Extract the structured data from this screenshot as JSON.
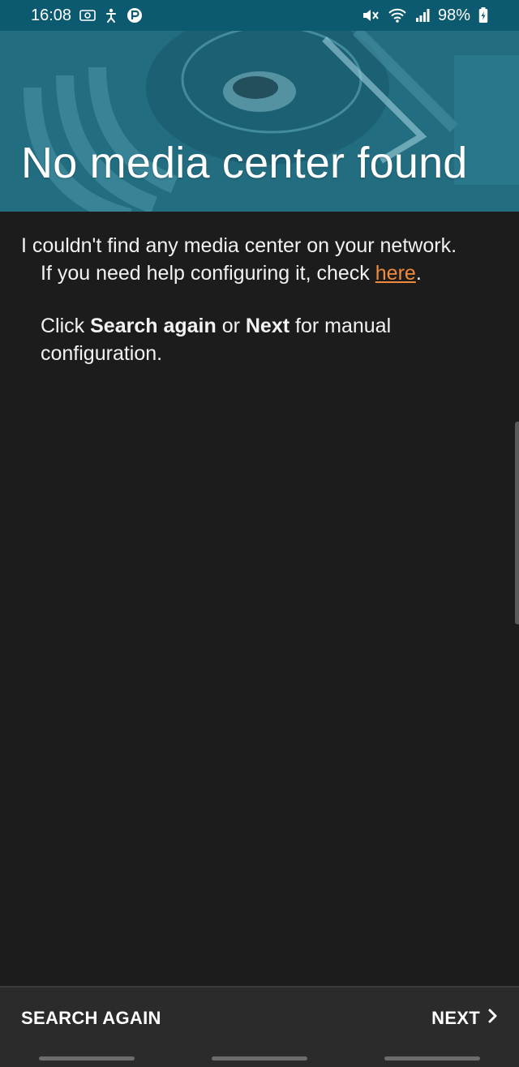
{
  "status_bar": {
    "time": "16:08",
    "left_icons": [
      "screenshot-icon",
      "accessibility-icon",
      "p-badge-icon"
    ],
    "right_icons": [
      "mute-icon",
      "wifi-icon",
      "signal-icon"
    ],
    "battery_percent": "98%",
    "battery_icon": "battery-charging-icon"
  },
  "header": {
    "title": "No media center found"
  },
  "content": {
    "line1": "I couldn't find any media center on your network.",
    "line2_prefix": "If you need help configuring it, check ",
    "link_text": "here",
    "line2_suffix": ".",
    "para2_prefix": "Click ",
    "para2_bold1": "Search again",
    "para2_mid": " or ",
    "para2_bold2": "Next",
    "para2_suffix": " for manual configuration."
  },
  "actions": {
    "search_again": "SEARCH AGAIN",
    "next": "NEXT",
    "next_icon": "chevron-right-icon"
  },
  "colors": {
    "status_bar": "#0b5a70",
    "background": "#1c1c1c",
    "link": "#f08a3c",
    "bottom_bar": "#2b2b2b"
  }
}
